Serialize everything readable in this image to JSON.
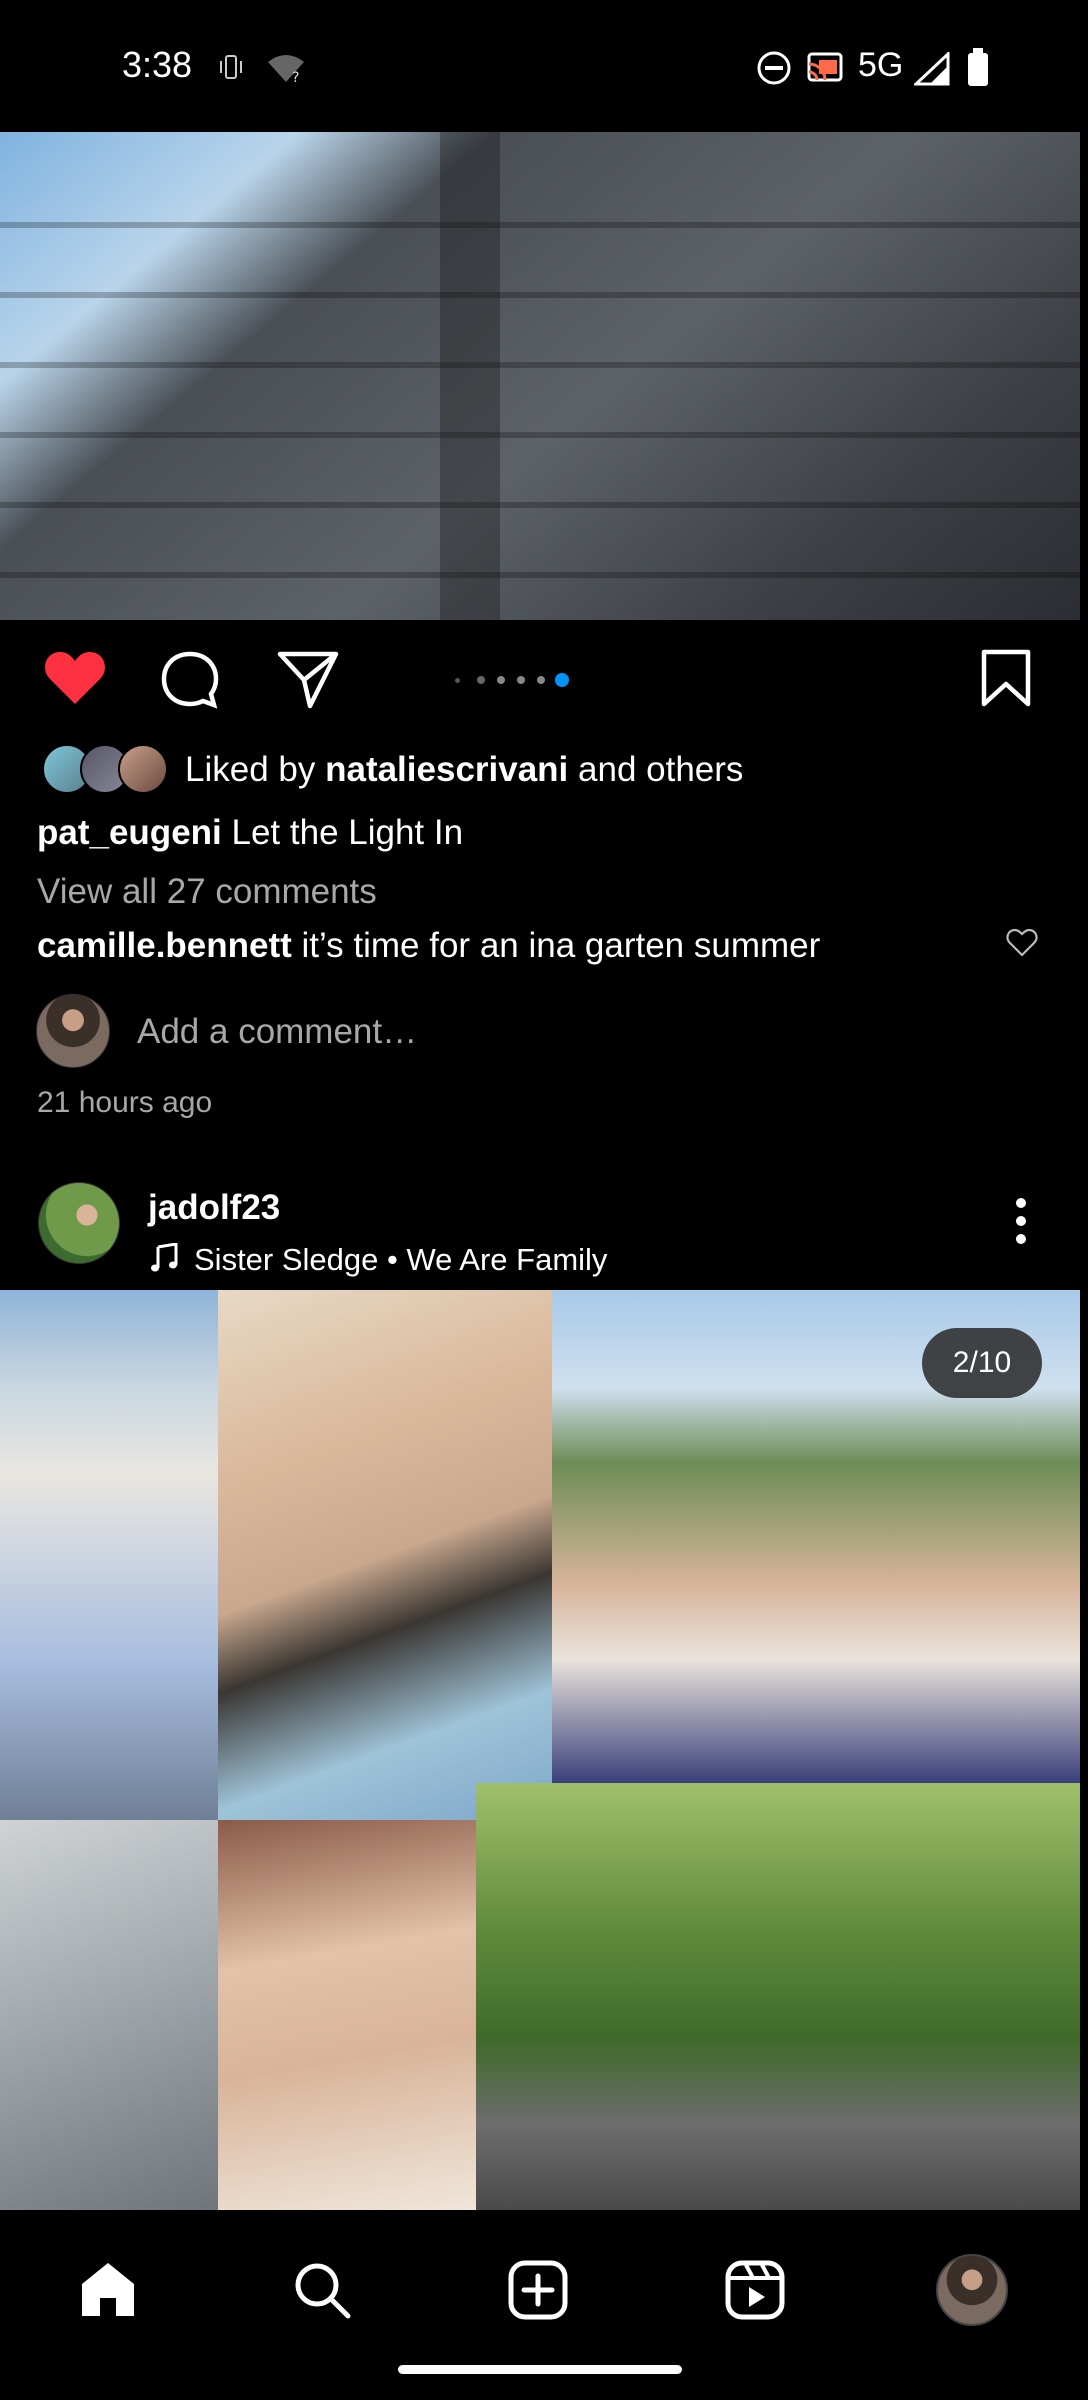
{
  "status_bar": {
    "time": "3:38",
    "network": "5G",
    "icons": [
      "vibrate-icon",
      "wifi-question-icon",
      "do-not-disturb-icon",
      "cast-icon",
      "signal-icon",
      "battery-icon"
    ]
  },
  "post1": {
    "carousel": {
      "total": 6,
      "active_index": 5
    },
    "likes_text_prefix": "Liked by ",
    "likes_user": "nataliescrivani",
    "likes_text_suffix": " and others",
    "author": "pat_eugeni",
    "caption": "Let the Light In",
    "view_comments": "View all 27 comments",
    "comment_user": "camille.bennett",
    "comment_text": "it’s time for an ina garten summer",
    "add_comment_placeholder": "Add a comment…",
    "timestamp": "21 hours ago"
  },
  "post2": {
    "author": "jadolf23",
    "audio": "Sister Sledge • We Are Family",
    "counter": "2/10"
  },
  "colors": {
    "like_red": "#ff3040",
    "dot_active": "#0095f6",
    "muted": "#a8a8a8"
  },
  "nav": {
    "items": [
      "home-icon",
      "search-icon",
      "create-icon",
      "reels-icon",
      "profile-avatar"
    ]
  }
}
